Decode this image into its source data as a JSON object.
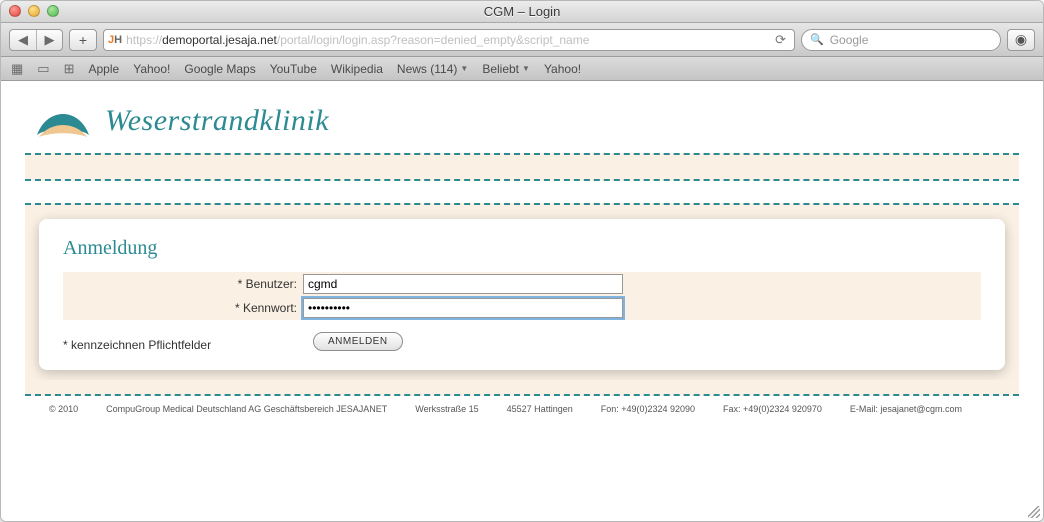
{
  "window": {
    "title": "CGM – Login"
  },
  "toolbar": {
    "url_prefix": "https://",
    "url_host": "demoportal.jesaja.net",
    "url_path": "/portal/login/login.asp?reason=denied_empty&script_name",
    "search_placeholder": "Google"
  },
  "bookmarks": {
    "items": [
      "Apple",
      "Yahoo!",
      "Google Maps",
      "YouTube",
      "Wikipedia"
    ],
    "news_label": "News (114)",
    "beliebt_label": "Beliebt",
    "extra": "Yahoo!"
  },
  "org": {
    "name": "Weserstrandklinik"
  },
  "login": {
    "heading": "Anmeldung",
    "user_label": "* Benutzer:",
    "user_value": "cgmd",
    "pass_label": "* Kennwort:",
    "pass_value": "••••••••••",
    "required_note": "* kennzeichnen Pflichtfelder",
    "submit_label": "ANMELDEN"
  },
  "footer": {
    "copyright": "© 2010",
    "company": "CompuGroup Medical Deutschland AG Geschäftsbereich JESAJANET",
    "street": "Werksstraße 15",
    "city": "45527 Hattingen",
    "phone": "Fon: +49(0)2324 92090",
    "fax": "Fax: +49(0)2324 920970",
    "email": "E-Mail: jesajanet@cgm.com"
  }
}
